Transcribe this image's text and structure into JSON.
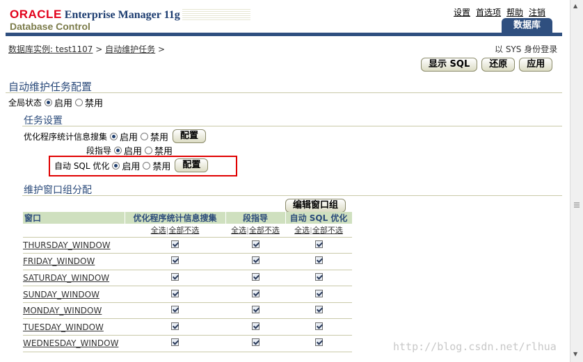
{
  "header": {
    "brand": "ORACLE",
    "product": "Enterprise Manager 11g",
    "subtitle": "Database Control",
    "links": [
      "设置",
      "首选项",
      "帮助",
      "注销"
    ],
    "tab": "数据库"
  },
  "breadcrumb": {
    "instance": "数据库实例: test1107",
    "page": "自动维护任务",
    "sep": ">"
  },
  "login": "以 SYS 身份登录",
  "buttons": {
    "show_sql": "显示 SQL",
    "revert": "还原",
    "apply": "应用",
    "edit_group": "编辑窗口组",
    "configure": "配置"
  },
  "page_title": "自动维护任务配置",
  "global_status": {
    "label": "全局状态",
    "enable": "启用",
    "disable": "禁用"
  },
  "task_settings": {
    "title": "任务设置",
    "rows": [
      {
        "label": "优化程序统计信息搜集",
        "enable": "启用",
        "disable": "禁用"
      },
      {
        "label": "段指导",
        "enable": "启用",
        "disable": "禁用"
      },
      {
        "label": "自动 SQL 优化",
        "enable": "启用",
        "disable": "禁用"
      }
    ]
  },
  "window_groups": {
    "title": "维护窗口组分配",
    "columns": [
      "窗口",
      "优化程序统计信息搜集",
      "段指导",
      "自动 SQL 优化"
    ],
    "select_all": "全选",
    "select_none": "全部不选",
    "windows": [
      "THURSDAY_WINDOW",
      "FRIDAY_WINDOW",
      "SATURDAY_WINDOW",
      "SUNDAY_WINDOW",
      "MONDAY_WINDOW",
      "TUESDAY_WINDOW",
      "WEDNESDAY_WINDOW"
    ]
  },
  "watermark": "http://blog.csdn.net/rlhua"
}
